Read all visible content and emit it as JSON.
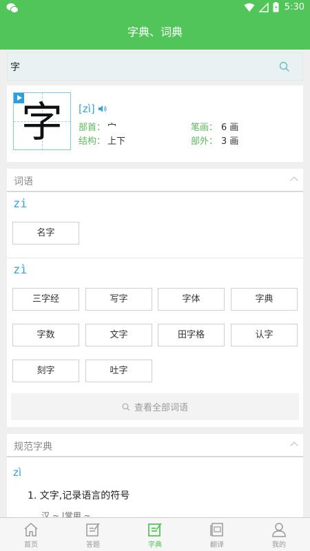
{
  "status": {
    "time": "5:30"
  },
  "header": {
    "title": "字典、词典"
  },
  "search": {
    "query": "字"
  },
  "entry": {
    "character": "字",
    "pinyin": "[zì]",
    "radical_label": "部首：",
    "radical": "宀",
    "strokes_label": "笔画：",
    "strokes": "6 画",
    "structure_label": "结构：",
    "structure": "上下",
    "outside_label": "部外：",
    "outside": "3 画"
  },
  "words": {
    "title": "词语",
    "groups": [
      {
        "pinyin": "zi",
        "items": [
          "名字"
        ]
      },
      {
        "pinyin": "zì",
        "items": [
          "三字经",
          "写字",
          "字体",
          "字典",
          "字数",
          "文字",
          "田字格",
          "认字",
          "刻字",
          "吐字"
        ]
      }
    ],
    "view_all": "查看全部词语"
  },
  "dictionary": {
    "title": "规范字典",
    "pinyin": "zì",
    "definition": "1. 文字,记录语言的符号",
    "example": "汉 ~ |常用 ~"
  },
  "tabs": [
    {
      "label": "首页",
      "icon": "home-icon"
    },
    {
      "label": "答题",
      "icon": "edit-icon"
    },
    {
      "label": "字典",
      "icon": "dictionary-icon",
      "active": true
    },
    {
      "label": "翻译",
      "icon": "translate-icon"
    },
    {
      "label": "我的",
      "icon": "profile-icon"
    }
  ],
  "colors": {
    "primary": "#52c55a",
    "pinyin": "#3aa0da"
  }
}
